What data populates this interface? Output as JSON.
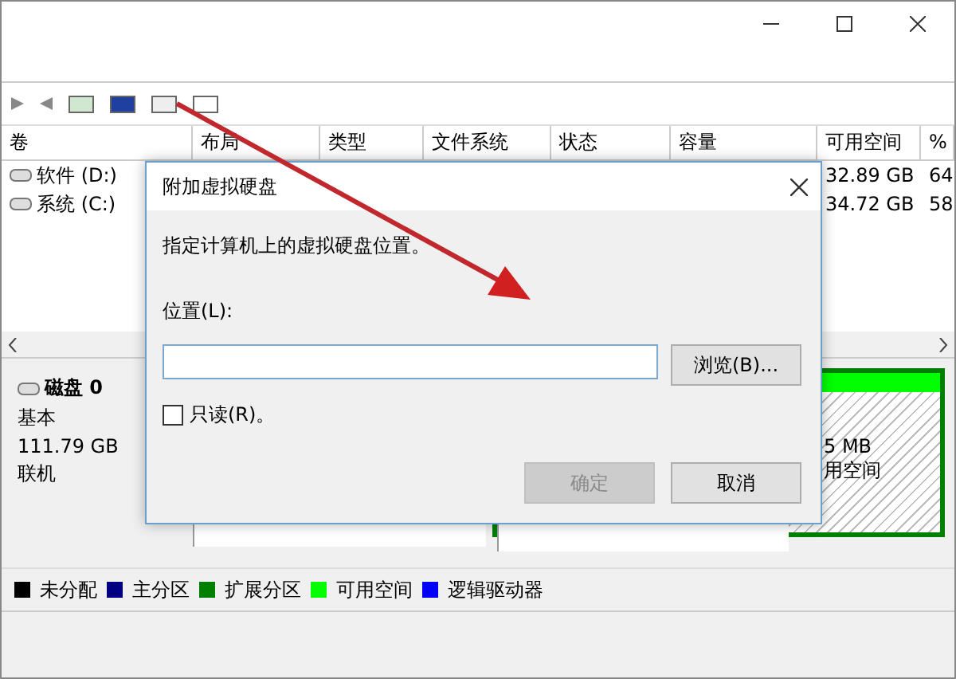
{
  "table": {
    "columns": [
      "卷",
      "布局",
      "类型",
      "文件系统",
      "状态",
      "容量",
      "可用空间",
      "%"
    ],
    "rows": [
      {
        "name": "软件 (D:)",
        "free": "32.89 GB",
        "percent": "64"
      },
      {
        "name": "系统 (C:)",
        "free": "34.72 GB",
        "percent": "58"
      }
    ]
  },
  "disk": {
    "name": "磁盘 0",
    "type": "基本",
    "size": "111.79 GB",
    "status": "联机",
    "free_size": "5 MB",
    "free_label": "用空间"
  },
  "legend": [
    {
      "label": "未分配",
      "color": "#000000"
    },
    {
      "label": "主分区",
      "color": "#000080"
    },
    {
      "label": "扩展分区",
      "color": "#008000"
    },
    {
      "label": "可用空间",
      "color": "#00ff00"
    },
    {
      "label": "逻辑驱动器",
      "color": "#0000ff"
    }
  ],
  "dialog": {
    "title": "附加虚拟硬盘",
    "instruction": "指定计算机上的虚拟硬盘位置。",
    "location_label": "位置(L):",
    "browse": "浏览(B)...",
    "readonly": {
      "label": "只读(R)。",
      "checked": false
    },
    "ok": {
      "label": "确定",
      "disabled": true
    },
    "cancel": {
      "label": "取消",
      "disabled": false
    }
  }
}
